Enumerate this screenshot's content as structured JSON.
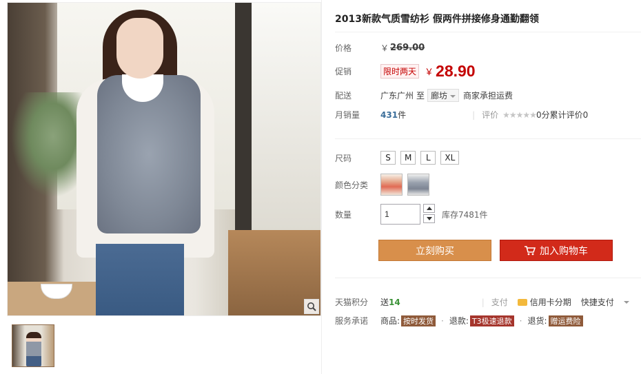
{
  "product": {
    "title": "2013新款气质雪纺衫 假两件拼接修身通勤翻领"
  },
  "price": {
    "label": "价格",
    "currency": "￥",
    "original": "269.00"
  },
  "promo": {
    "label": "促销",
    "tag": "限时两天",
    "currency": "￥",
    "price": "28.90"
  },
  "shipping": {
    "label": "配送",
    "from": "广东广州",
    "to_word": "至",
    "destination": "廊坊",
    "note": "商家承担运费"
  },
  "sales": {
    "label": "月销量",
    "count": "431",
    "unit": "件",
    "rating_label": "评价",
    "stars": "★★★★★",
    "rating_text": "0分累计评价0"
  },
  "size": {
    "label": "尺码",
    "options": [
      "S",
      "M",
      "L",
      "XL"
    ]
  },
  "color": {
    "label": "颜色分类"
  },
  "quantity": {
    "label": "数量",
    "value": "1",
    "stock": "库存7481件"
  },
  "buttons": {
    "buy": "立刻购买",
    "cart": "加入购物车"
  },
  "points": {
    "label": "天猫积分",
    "prefix": "送",
    "value": "14"
  },
  "payment": {
    "label": "支付",
    "credit": "信用卡分期",
    "quick": "快捷支付"
  },
  "service": {
    "label": "服务承诺",
    "goods_label": "商品:",
    "goods_tag": "按时发货",
    "refund_label": "退款:",
    "refund_tag": "T3极速退款",
    "return_label": "退货:",
    "return_tag": "赠运费险"
  },
  "colors": {
    "price_red": "#c40000",
    "buy_button": "#d88f4b",
    "cart_button": "#d22a1a"
  }
}
